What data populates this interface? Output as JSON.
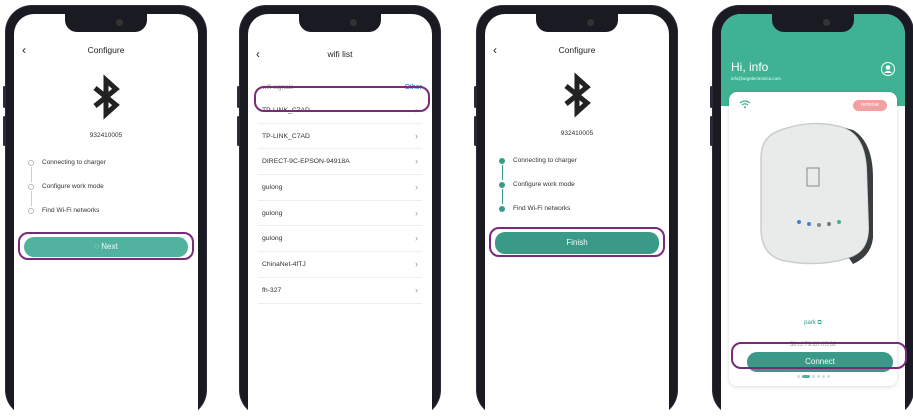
{
  "screen1": {
    "title": "Configure",
    "back_icon": "back-chevron-icon",
    "icon": "bluetooth-icon",
    "serial": "932410005",
    "steps": [
      "Connecting to charger",
      "Configure work mode",
      "Find Wi-Fi networks"
    ],
    "button_label": "Next"
  },
  "screen2": {
    "title": "wifi list",
    "back_icon": "back-chevron-icon",
    "subtitle": "wifi signals",
    "other_label": "Other",
    "networks": [
      "TP-LINK_C7AD",
      "TP-LINK_C7AD",
      "DIRECT-9C-EPSON-94918A",
      "gulong",
      "gulong",
      "gulong",
      "ChinaNet-4fTJ",
      "fh-327"
    ]
  },
  "screen3": {
    "title": "Configure",
    "back_icon": "back-chevron-icon",
    "icon": "bluetooth-icon",
    "serial": "932410005",
    "steps": [
      "Connecting to charger",
      "Configure work mode",
      "Find Wi-Fi networks"
    ],
    "button_label": "Finish"
  },
  "screen4": {
    "greeting": "Hi,  info",
    "email": "info@urgelectronica.com",
    "remove_label": "remove",
    "device_name": "park",
    "mac": "58:cf:79:20:05:62",
    "button_label": "Connect"
  },
  "colors": {
    "accent": "#52b2a0",
    "accent_dark": "#3a9a87",
    "highlight": "#7a2a78",
    "header_green": "#3fb294",
    "link_blue": "#1e6fd0"
  }
}
